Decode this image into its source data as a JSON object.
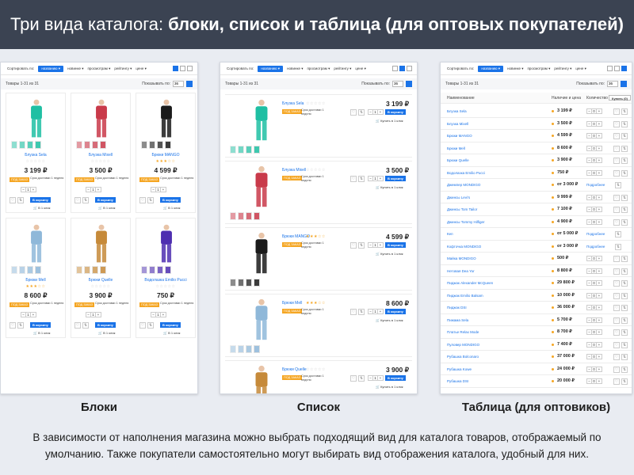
{
  "header": {
    "title_regular": "Три вида каталога:",
    "title_bold": "блоки, список и таблица (для оптовых покупателей)"
  },
  "captions": {
    "blocks": "Блоки",
    "list": "Список",
    "table": "Таблица (для оптовиков)"
  },
  "description": "В зависимости от наполнения магазина можно выбрать подходящий вид для каталога товаров, отображаемый по умолчанию. Также покупатели самостоятельно могут выбирать вид отображения каталога, удобный для них.",
  "ui": {
    "sort_label": "Сортировать по:",
    "sort_options": [
      "названию",
      "новинке",
      "просмотрам",
      "рейтингу",
      "цене"
    ],
    "count_text": "Товары 1-31 из 31",
    "per_page_label": "Показывать по:",
    "per_page_value": "36",
    "badge": "ПОД ЗАКАЗ",
    "delivery": "Срок доставки 1 неделя",
    "cart": "В корзину",
    "one_click": "В 1 клик",
    "one_click_list": "Купить в 1 клик",
    "col_name": "Наименование",
    "col_price": "Наличие и цена",
    "col_qty": "Количество",
    "buy_button": "Купить (0)",
    "details": "Подробнее"
  },
  "blocks": [
    {
      "name": "Блузка Sela",
      "price": "3 199 ₽",
      "color": "#1fbfa3",
      "rating": 0
    },
    {
      "name": "Блузка Mixell",
      "price": "3 500 ₽",
      "color": "#c93a4a",
      "rating": 0
    },
    {
      "name": "Брюки MANGO",
      "price": "4 599 ₽",
      "color": "#1b1b1b",
      "rating": 3
    },
    {
      "name": "Брюки Mell",
      "price": "8 600 ₽",
      "color": "#8fb8d9",
      "rating": 3
    },
    {
      "name": "Брюки Quelle",
      "price": "3 900 ₽",
      "color": "#c68a3a",
      "rating": 0
    },
    {
      "name": "Водолазка Emilio Pucci",
      "price": "750 ₽",
      "color": "#4e2fb0",
      "rating": 0
    }
  ],
  "list": [
    {
      "name": "Блузка Sela",
      "price": "3 199 ₽",
      "color": "#1fbfa3",
      "rating": 0
    },
    {
      "name": "Блузка Mixell",
      "price": "3 500 ₽",
      "color": "#c93a4a",
      "rating": 0
    },
    {
      "name": "Брюки MANGO",
      "price": "4 599 ₽",
      "color": "#1b1b1b",
      "rating": 3
    },
    {
      "name": "Брюки Mell",
      "price": "8 600 ₽",
      "color": "#8fb8d9",
      "rating": 3
    },
    {
      "name": "Брюки Quelle",
      "price": "3 900 ₽",
      "color": "#c68a3a",
      "rating": 0
    }
  ],
  "table": [
    {
      "name": "Блузка Sela",
      "price": "3 199 ₽"
    },
    {
      "name": "Блузка Mixell",
      "price": "3 500 ₽"
    },
    {
      "name": "Брюки MANGO",
      "price": "4 599 ₽"
    },
    {
      "name": "Брюки Mell",
      "price": "8 600 ₽"
    },
    {
      "name": "Брюки Quelle",
      "price": "3 900 ₽"
    },
    {
      "name": "Водолазка Emilio Pucci",
      "price": "750 ₽"
    },
    {
      "name": "Джемпер MONDIGO",
      "price": "от 3 000 ₽",
      "details": true
    },
    {
      "name": "Джинсы Levi's",
      "price": "9 999 ₽"
    },
    {
      "name": "Джинсы Tom Tailor",
      "price": "7 100 ₽"
    },
    {
      "name": "Джинсы Tommy Hilfiger",
      "price": "4 900 ₽"
    },
    {
      "name": "Кеп",
      "price": "от 5 000 ₽",
      "details": true
    },
    {
      "name": "Кофточка MONDIGO",
      "price": "от 3 000 ₽",
      "details": true
    },
    {
      "name": "Майка MONDIGO",
      "price": "500 ₽"
    },
    {
      "name": "Нетовая Dea Yor",
      "price": "8 800 ₽"
    },
    {
      "name": "Пиджак Alexander McQueen",
      "price": "29 800 ₽"
    },
    {
      "name": "Пиджак Emilio Balsam",
      "price": "10 000 ₽"
    },
    {
      "name": "Пиджак DSI",
      "price": "36 000 ₽"
    },
    {
      "name": "Пижама Sela",
      "price": "5 700 ₽"
    },
    {
      "name": "Платье Relax Mode",
      "price": "8 700 ₽"
    },
    {
      "name": "Пуловер MONDIGO",
      "price": "7 400 ₽"
    },
    {
      "name": "Рубашка Bolconaro",
      "price": "37 000 ₽"
    },
    {
      "name": "Рубашка Kowe",
      "price": "24 000 ₽"
    },
    {
      "name": "Рубашка DSI",
      "price": "20 000 ₽"
    }
  ]
}
